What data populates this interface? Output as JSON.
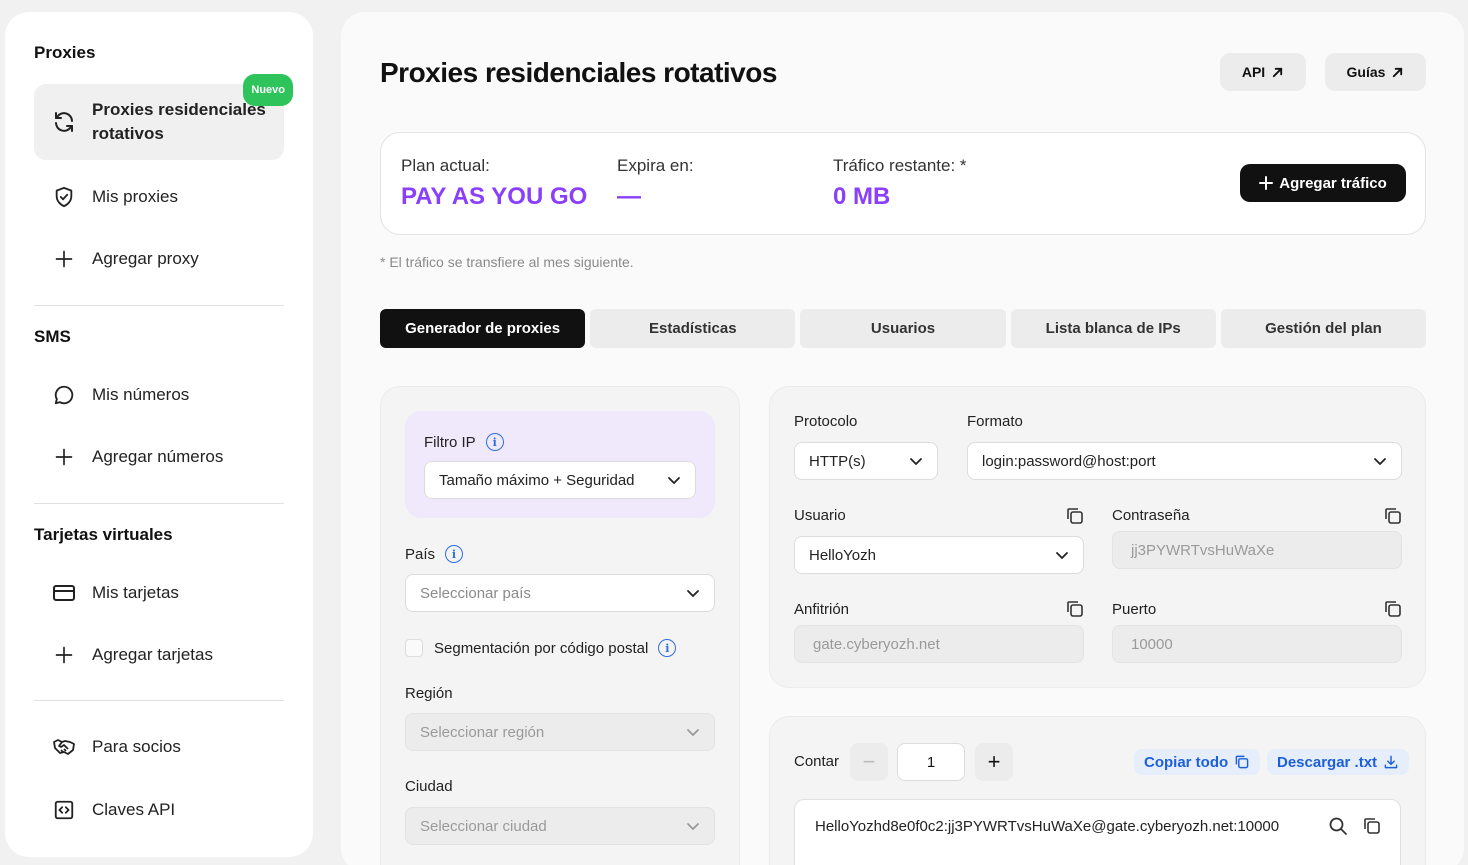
{
  "sidebar": {
    "proxies_title": "Proxies",
    "proxies_items": [
      {
        "label": "Proxies residenciales rotativos",
        "badge": "Nuevo",
        "icon": "refresh-icon"
      },
      {
        "label": "Mis proxies",
        "icon": "shield-icon"
      },
      {
        "label": "Agregar proxy",
        "icon": "plus-icon"
      }
    ],
    "sms_title": "SMS",
    "sms_items": [
      {
        "label": "Mis números",
        "icon": "chat-icon"
      },
      {
        "label": "Agregar números",
        "icon": "plus-icon"
      }
    ],
    "cards_title": "Tarjetas virtuales",
    "cards_items": [
      {
        "label": "Mis tarjetas",
        "icon": "credit-card-icon"
      },
      {
        "label": "Agregar tarjetas",
        "icon": "plus-icon"
      }
    ],
    "other_items": [
      {
        "label": "Para socios",
        "icon": "handshake-icon"
      },
      {
        "label": "Claves API",
        "icon": "code-icon"
      }
    ]
  },
  "header": {
    "title": "Proxies residenciales rotativos",
    "api_label": "API",
    "guides_label": "Guías"
  },
  "plan": {
    "plan_label": "Plan actual:",
    "plan_value": "PAY AS YOU GO",
    "expires_label": "Expira en:",
    "expires_value": "—",
    "traffic_label": "Tráfico restante: *",
    "traffic_value": "0 MB",
    "add_traffic_label": "Agregar tráfico",
    "note": "* El tráfico se transfiere al mes siguiente."
  },
  "tabs": [
    {
      "label": "Generador de proxies",
      "active": true
    },
    {
      "label": "Estadísticas"
    },
    {
      "label": "Usuarios"
    },
    {
      "label": "Lista blanca de IPs"
    },
    {
      "label": "Gestión del plan"
    }
  ],
  "left_panel": {
    "filter_label": "Filtro IP",
    "filter_value": "Tamaño máximo + Seguridad",
    "country_label": "País",
    "country_placeholder": "Seleccionar país",
    "postal_label": "Segmentación por código postal",
    "region_label": "Región",
    "region_placeholder": "Seleccionar región",
    "city_label": "Ciudad",
    "city_placeholder": "Seleccionar ciudad"
  },
  "right_panel": {
    "protocol_label": "Protocolo",
    "protocol_value": "HTTP(s)",
    "format_label": "Formato",
    "format_value": "login:password@host:port",
    "user_label": "Usuario",
    "user_value": "HelloYozh",
    "password_label": "Contraseña",
    "password_value": "jj3PYWRTvsHuWaXe",
    "host_label": "Anfitrión",
    "host_value": "gate.cyberyozh.net",
    "port_label": "Puerto",
    "port_value": "10000"
  },
  "output": {
    "count_label": "Contar",
    "count_value": "1",
    "copy_all_label": "Copiar todo",
    "download_label": "Descargar .txt",
    "result_line": "HelloYozhd8e0f0c2:jj3PYWRTvsHuWaXe@gate.cyberyozh.net:10000"
  },
  "colors": {
    "accent_purple": "#8a3ffc",
    "badge_green": "#2ec35b",
    "link_blue": "#1d5fd8"
  }
}
